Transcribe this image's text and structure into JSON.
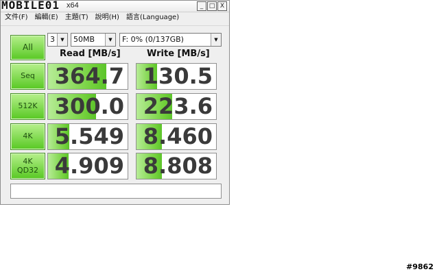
{
  "titlebar": {
    "logo_text": "MOBILE01",
    "title_suffix": "x64",
    "min_label": "_",
    "max_label": "□",
    "close_label": "X"
  },
  "menu": [
    "文件(F)",
    "編輯(E)",
    "主題(T)",
    "說明(H)",
    "語言(Language)"
  ],
  "controls": {
    "all_label": "All",
    "count": "3",
    "size": "50MB",
    "drive": "F: 0% (0/137GB)"
  },
  "columns": {
    "read": "Read [MB/s]",
    "write": "Write [MB/s]"
  },
  "rows": [
    {
      "label": "Seq",
      "label2": "",
      "read": "364.7",
      "write": "130.5",
      "read_fill": 0.73,
      "write_fill": 0.26
    },
    {
      "label": "512K",
      "label2": "",
      "read": "300.0",
      "write": "223.6",
      "read_fill": 0.6,
      "write_fill": 0.45
    },
    {
      "label": "4K",
      "label2": "",
      "read": "5.549",
      "write": "8.460",
      "read_fill": 0.27,
      "write_fill": 0.32
    },
    {
      "label": "4K",
      "label2": "QD32",
      "read": "4.909",
      "write": "8.808",
      "read_fill": 0.26,
      "write_fill": 0.32
    }
  ],
  "watermark": "#9862",
  "colors": {
    "button_green": "#58c823",
    "bar_green": "#74d13d",
    "window_bg": "#efefef"
  }
}
